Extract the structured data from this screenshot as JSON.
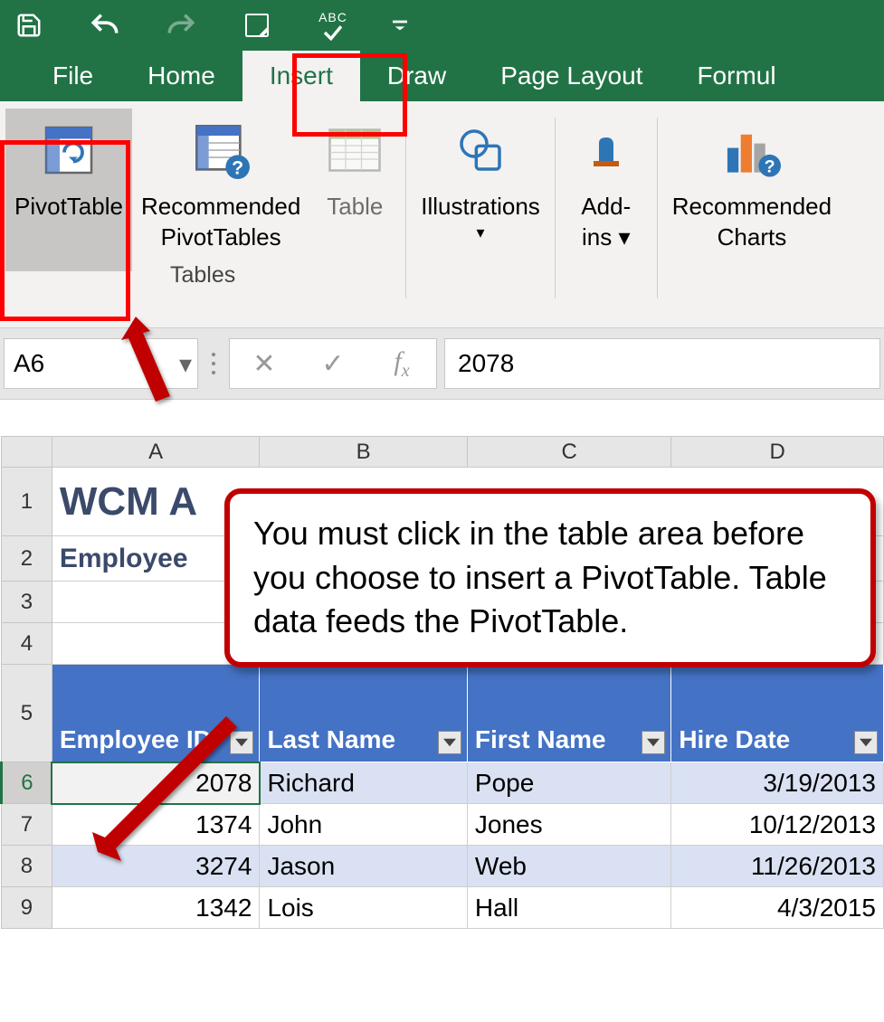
{
  "qat": {
    "save": "save",
    "undo": "undo",
    "redo": "redo",
    "touch": "touch-mode",
    "spell": "spellcheck",
    "customize": "customize"
  },
  "tabs": [
    "File",
    "Home",
    "Insert",
    "Draw",
    "Page Layout",
    "Formul"
  ],
  "active_tab": "Insert",
  "ribbon": {
    "pivot": "PivotTable",
    "recpivot_l1": "Recommended",
    "recpivot_l2": "PivotTables",
    "table": "Table",
    "illus_l1": "Illustrations",
    "illus_dd": "▾",
    "addins_l1": "Add-",
    "addins_l2": "ins ▾",
    "reccharts_l1": "Recommended",
    "reccharts_l2": "Charts",
    "group_tables": "Tables"
  },
  "namebox": "A6",
  "formula_value": "2078",
  "sheet": {
    "col_headers": [
      "A",
      "B",
      "C",
      "D"
    ],
    "row_headers": [
      "1",
      "2",
      "3",
      "4",
      "5",
      "6",
      "7",
      "8",
      "9"
    ],
    "title": "WCM A",
    "subtitle": "Employee",
    "th": [
      "Employee ID",
      "Last Name",
      "First Name",
      "Hire Date"
    ],
    "rows": [
      {
        "id": "2078",
        "last": "Richard",
        "first": "Pope",
        "hire": "3/19/2013",
        "alt": true,
        "sel": true
      },
      {
        "id": "1374",
        "last": "John",
        "first": "Jones",
        "hire": "10/12/2013",
        "alt": false
      },
      {
        "id": "3274",
        "last": "Jason",
        "first": "Web",
        "hire": "11/26/2013",
        "alt": true
      },
      {
        "id": "1342",
        "last": "Lois",
        "first": "Hall",
        "hire": "4/3/2015",
        "alt": false
      }
    ]
  },
  "callout_text": "You must click in the table area before you choose to insert a PivotTable. Table data feeds the PivotTable."
}
